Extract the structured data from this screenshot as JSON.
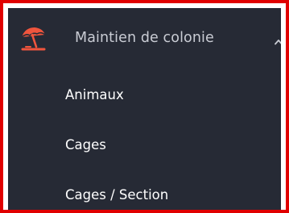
{
  "menu": {
    "header": {
      "icon": "beach-umbrella-icon",
      "label": "Maintien de colonie",
      "expanded_indicator": "chevron-up-icon",
      "icon_color": "#f0553d"
    },
    "items": [
      {
        "label": "Animaux"
      },
      {
        "label": "Cages"
      },
      {
        "label": "Cages / Section"
      }
    ]
  },
  "colors": {
    "highlight_border": "#e00000",
    "panel_background": "#262a35",
    "accent": "#f0553d"
  }
}
